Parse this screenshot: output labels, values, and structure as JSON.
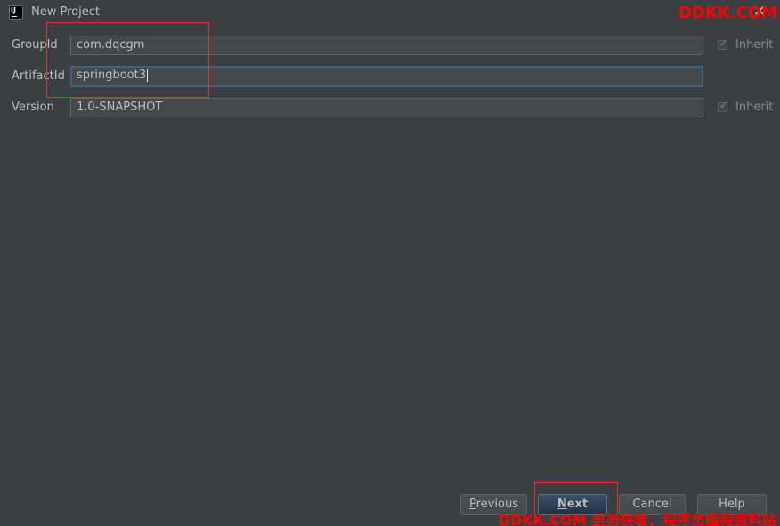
{
  "window": {
    "title": "New Project"
  },
  "form": {
    "group_id": {
      "label": "GroupId",
      "value": "com.dqcgm"
    },
    "artifact_id": {
      "label": "ArtifactId",
      "value": "springboot3"
    },
    "version": {
      "label": "Version",
      "value": "1.0-SNAPSHOT"
    },
    "inherit_label": "Inherit"
  },
  "buttons": {
    "previous": {
      "prefix": "",
      "underlined": "P",
      "rest": "revious"
    },
    "next": {
      "prefix": "",
      "underlined": "N",
      "rest": "ext"
    },
    "cancel": "Cancel",
    "help": "Help"
  },
  "watermarks": {
    "top": "DDKK.COM",
    "bottom": "DDKK.COM 弟弟快看，程序员编程资料站"
  },
  "colors": {
    "background": "#3c3f41",
    "field_bg": "#45494a",
    "focus_border": "#3d6185",
    "annotation_red": "#e0312f"
  }
}
